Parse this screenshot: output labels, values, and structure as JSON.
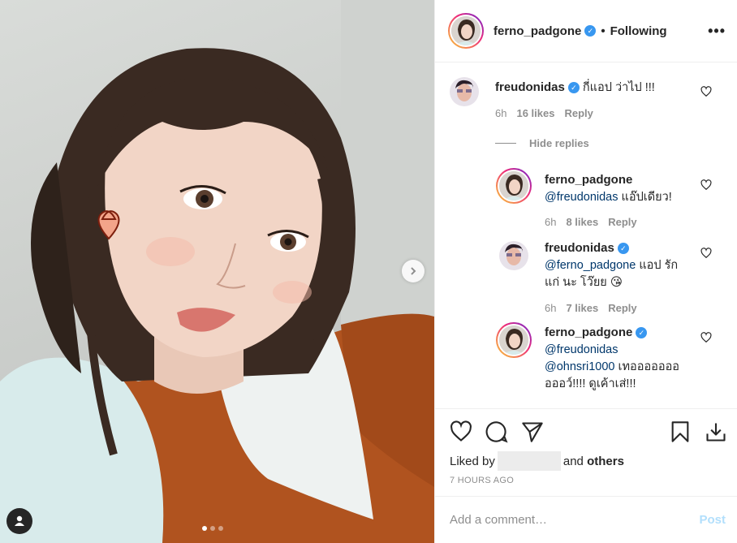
{
  "header": {
    "username": "ferno_padgone",
    "follow_separator": "•",
    "follow_status": "Following",
    "more": "•••"
  },
  "comments": [
    {
      "username": "freudonidas",
      "verified": true,
      "text": "กี่แอป ว่าไป !!!",
      "time": "6h",
      "likes": "16 likes",
      "reply": "Reply"
    }
  ],
  "hide_replies": "Hide replies",
  "replies": [
    {
      "username": "ferno_padgone",
      "verified": false,
      "mention": "@freudonidas",
      "text": " แอ๊ปเดียว!",
      "time": "6h",
      "likes": "8 likes",
      "reply": "Reply"
    },
    {
      "username": "freudonidas",
      "verified": true,
      "mention": "@ferno_padgone",
      "text": " แอป รัก",
      "text2": "แก่ นะ โว๊ยย 😘",
      "time": "6h",
      "likes": "7 likes",
      "reply": "Reply"
    },
    {
      "username": "ferno_padgone",
      "verified": true,
      "mention": "@freudonidas",
      "mention2": "@ohnsri1000",
      "text": " เทอออออออ",
      "text2": "อออว์!!!! ดูเค้าเส่!!!"
    }
  ],
  "likes_line": {
    "prefix": "Liked by",
    "middle": "and",
    "suffix": "others"
  },
  "timestamp": "7 HOURS AGO",
  "comment_box": {
    "placeholder": "Add a comment…",
    "post_label": "Post"
  },
  "carousel": {
    "total": 3,
    "active": 1
  },
  "colors": {
    "verified": "#3897f0",
    "mention": "#00376b",
    "muted": "#8e8e8e",
    "post_disabled": "#b2dffc"
  }
}
